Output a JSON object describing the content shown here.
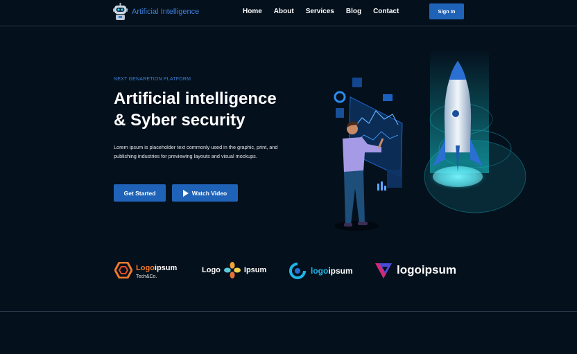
{
  "brand": {
    "label": "Artificial Intelligence"
  },
  "nav": {
    "items": [
      "Home",
      "About",
      "Services",
      "Blog",
      "Contact"
    ]
  },
  "header": {
    "signin_label": "Sign In"
  },
  "hero": {
    "eyebrow": "NEXT GENARETION PLATFORM",
    "headline_line1": "Artificial intelligence",
    "headline_line2": "& Syber security",
    "description": "Lorem ipsum is placeholder text commonly used in the graphic, print, and publishing industries for previewing layouts and visual mockups.",
    "cta_primary": "Get Started",
    "cta_secondary": "Watch Video"
  },
  "partners": {
    "logo1_main_a": "Logo",
    "logo1_main_b": "ipsum",
    "logo1_sub": "Tech&Co.",
    "logo2_left": "Logo",
    "logo2_right": "Ipsum",
    "logo3_a": "logo",
    "logo3_b": "ipsum",
    "logo4": "logoipsum"
  },
  "colors": {
    "background": "#04101c",
    "accent": "#1f63b8",
    "brand_text": "#3f7fd8",
    "cyan": "#1fb4e8",
    "orange": "#f07a2a"
  },
  "icons": {
    "brand": "robot-icon",
    "play": "play-icon"
  }
}
